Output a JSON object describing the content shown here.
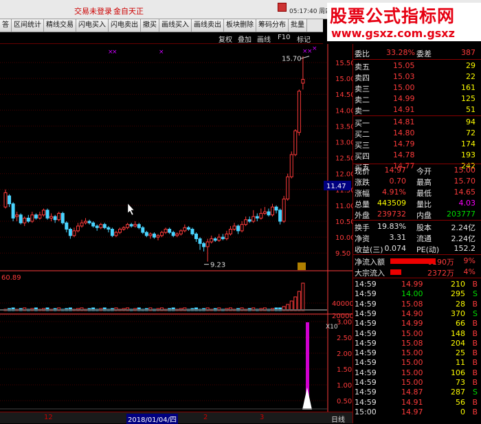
{
  "titlebar": {
    "login_status": "交易未登录",
    "broker": "金自天正",
    "clock": "05:17:40 周四",
    "close_label": "✕"
  },
  "toolbar": {
    "items": [
      "答",
      "区间统计",
      "精线交易",
      "闪电买入",
      "闪电卖出",
      "撤买",
      "画线买入",
      "画线卖出",
      "板块删除",
      "筹码分布",
      "批量"
    ]
  },
  "subbar": {
    "items": [
      "复权",
      "叠加",
      "画线",
      "F10",
      "标记"
    ]
  },
  "watermark": {
    "title": "股票公式指标网",
    "url": "www.gsxz.com.gsxz"
  },
  "price_chart": {
    "y_labels": [
      "15.50",
      "15.00",
      "14.50",
      "14.00",
      "13.50",
      "13.00",
      "12.50",
      "12.00",
      "11.50",
      "11.00",
      "10.50",
      "10.00",
      "9.50"
    ],
    "high_note": "15.70",
    "low_note": "9.23",
    "current_tag": "11.47",
    "colors": {
      "up": "#ff3b3b",
      "down": "#4ad4ff",
      "axis": "#ff3b3b"
    }
  },
  "volume_chart": {
    "top_value": "60.89",
    "y_labels": [
      "40000",
      "20000"
    ],
    "unit": "X10"
  },
  "indicator_chart": {
    "y_labels": [
      "3.00",
      "2.50",
      "2.00",
      "1.50",
      "1.00",
      "0.50"
    ]
  },
  "bottom_bar": {
    "ticks": [
      "12",
      "2018/01/04/四",
      "2",
      "3"
    ],
    "period": "日线"
  },
  "right_panel": {
    "weibi_label": "委比",
    "weibi_value": "33.28%",
    "weicha_label": "委差",
    "weicha_value": "387",
    "sells": [
      {
        "label": "卖五",
        "price": "15.05",
        "vol": "29"
      },
      {
        "label": "卖四",
        "price": "15.03",
        "vol": "22"
      },
      {
        "label": "卖三",
        "price": "15.00",
        "vol": "161"
      },
      {
        "label": "卖二",
        "price": "14.99",
        "vol": "125"
      },
      {
        "label": "卖一",
        "price": "14.91",
        "vol": "51"
      }
    ],
    "buys": [
      {
        "label": "买一",
        "price": "14.81",
        "vol": "94"
      },
      {
        "label": "买二",
        "price": "14.80",
        "vol": "72"
      },
      {
        "label": "买三",
        "price": "14.79",
        "vol": "174"
      },
      {
        "label": "买四",
        "price": "14.78",
        "vol": "193"
      },
      {
        "label": "买五",
        "price": "14.77",
        "vol": "242"
      }
    ],
    "quote": [
      {
        "l1": "现价",
        "v1": "14.97",
        "l2": "今开",
        "v2": "15.00"
      },
      {
        "l1": "涨跌",
        "v1": "0.70",
        "l2": "最高",
        "v2": "15.70"
      },
      {
        "l1": "涨幅",
        "v1": "4.91%",
        "l2": "最低",
        "v2": "14.65"
      },
      {
        "l1": "总量",
        "v1": "443509",
        "l2": "量比",
        "v2": "4.03"
      },
      {
        "l1": "外盘",
        "v1": "239732",
        "l2": "内盘",
        "v2": "203777"
      }
    ],
    "fin": [
      {
        "l1": "换手",
        "v1": "19.83%",
        "l2": "股本",
        "v2": "2.24亿"
      },
      {
        "l1": "净资",
        "v1": "3.31",
        "l2": "流通",
        "v2": "2.24亿"
      },
      {
        "l1": "收益(三)",
        "v1": "0.074",
        "l2": "PE(动)",
        "v2": "152.2"
      }
    ],
    "flows": [
      {
        "label": "净流入额",
        "value": "6190万",
        "pct": "9%"
      },
      {
        "label": "大宗流入",
        "value": "2372万",
        "pct": "4%"
      }
    ],
    "ticks": [
      {
        "time": "14:59",
        "price": "14.99",
        "vol": "210",
        "dir": "B"
      },
      {
        "time": "14:59",
        "price": "14.00",
        "vol": "295",
        "dir": "S"
      },
      {
        "time": "14:59",
        "price": "15.08",
        "vol": "28",
        "dir": "B"
      },
      {
        "time": "14:59",
        "price": "14.90",
        "vol": "370",
        "dir": "S"
      },
      {
        "time": "14:59",
        "price": "14.99",
        "vol": "66",
        "dir": "B"
      },
      {
        "time": "14:59",
        "price": "15.00",
        "vol": "148",
        "dir": "B"
      },
      {
        "time": "14:59",
        "price": "15.08",
        "vol": "204",
        "dir": "B"
      },
      {
        "time": "14:59",
        "price": "15.00",
        "vol": "25",
        "dir": "B"
      },
      {
        "time": "14:59",
        "price": "15.00",
        "vol": "11",
        "dir": "B"
      },
      {
        "time": "14:59",
        "price": "15.00",
        "vol": "106",
        "dir": "B"
      },
      {
        "time": "14:59",
        "price": "15.00",
        "vol": "73",
        "dir": "B"
      },
      {
        "time": "14:59",
        "price": "14.87",
        "vol": "287",
        "dir": "S"
      },
      {
        "time": "14:59",
        "price": "14.91",
        "vol": "56",
        "dir": "B"
      },
      {
        "time": "15:00",
        "price": "14.97",
        "vol": "0",
        "dir": "B"
      }
    ]
  }
}
